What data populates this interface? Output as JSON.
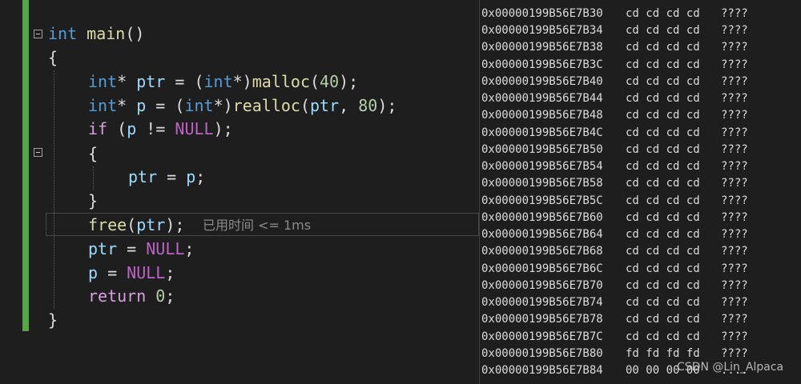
{
  "code": {
    "line1": {
      "kw": "int",
      "fn": "main",
      "rest": "()"
    },
    "line2": "{",
    "line3": {
      "t1": "int",
      "t2": "* ",
      "id1": "ptr",
      "t3": " = (",
      "t4": "int",
      "t5": "*)",
      "fn": "malloc",
      "t6": "(",
      "num": "40",
      "t7": ");"
    },
    "line4": {
      "t1": "int",
      "t2": "* ",
      "id1": "p",
      "t3": " = (",
      "t4": "int",
      "t5": "*)",
      "fn": "realloc",
      "t6": "(",
      "id2": "ptr",
      "t7": ", ",
      "num": "80",
      "t8": ");"
    },
    "line5": {
      "kw": "if",
      "t1": " (",
      "id1": "p",
      "t2": " != ",
      "mac": "NULL",
      "t3": ");"
    },
    "line6": "{",
    "line7": {
      "id1": "ptr",
      "t1": " = ",
      "id2": "p",
      "t2": ";"
    },
    "line8": "}",
    "line9": {
      "fn": "free",
      "t1": "(",
      "id1": "ptr",
      "t2": ");"
    },
    "line10": {
      "id1": "ptr",
      "t1": " = ",
      "mac": "NULL",
      "t2": ";"
    },
    "line11": {
      "id1": "p",
      "t1": " = ",
      "mac": "NULL",
      "t2": ";"
    },
    "line12": {
      "kw": "return",
      "t1": " ",
      "num": "0",
      "t2": ";"
    },
    "line13": "}"
  },
  "perf_tip": "已用时间 <= 1ms",
  "memory_rows": [
    {
      "addr": "0x00000199B56E7B30",
      "bytes": "cd cd cd cd",
      "ascii": "????"
    },
    {
      "addr": "0x00000199B56E7B34",
      "bytes": "cd cd cd cd",
      "ascii": "????"
    },
    {
      "addr": "0x00000199B56E7B38",
      "bytes": "cd cd cd cd",
      "ascii": "????"
    },
    {
      "addr": "0x00000199B56E7B3C",
      "bytes": "cd cd cd cd",
      "ascii": "????"
    },
    {
      "addr": "0x00000199B56E7B40",
      "bytes": "cd cd cd cd",
      "ascii": "????"
    },
    {
      "addr": "0x00000199B56E7B44",
      "bytes": "cd cd cd cd",
      "ascii": "????"
    },
    {
      "addr": "0x00000199B56E7B48",
      "bytes": "cd cd cd cd",
      "ascii": "????"
    },
    {
      "addr": "0x00000199B56E7B4C",
      "bytes": "cd cd cd cd",
      "ascii": "????"
    },
    {
      "addr": "0x00000199B56E7B50",
      "bytes": "cd cd cd cd",
      "ascii": "????"
    },
    {
      "addr": "0x00000199B56E7B54",
      "bytes": "cd cd cd cd",
      "ascii": "????"
    },
    {
      "addr": "0x00000199B56E7B58",
      "bytes": "cd cd cd cd",
      "ascii": "????"
    },
    {
      "addr": "0x00000199B56E7B5C",
      "bytes": "cd cd cd cd",
      "ascii": "????"
    },
    {
      "addr": "0x00000199B56E7B60",
      "bytes": "cd cd cd cd",
      "ascii": "????"
    },
    {
      "addr": "0x00000199B56E7B64",
      "bytes": "cd cd cd cd",
      "ascii": "????"
    },
    {
      "addr": "0x00000199B56E7B68",
      "bytes": "cd cd cd cd",
      "ascii": "????"
    },
    {
      "addr": "0x00000199B56E7B6C",
      "bytes": "cd cd cd cd",
      "ascii": "????"
    },
    {
      "addr": "0x00000199B56E7B70",
      "bytes": "cd cd cd cd",
      "ascii": "????"
    },
    {
      "addr": "0x00000199B56E7B74",
      "bytes": "cd cd cd cd",
      "ascii": "????"
    },
    {
      "addr": "0x00000199B56E7B78",
      "bytes": "cd cd cd cd",
      "ascii": "????"
    },
    {
      "addr": "0x00000199B56E7B7C",
      "bytes": "cd cd cd cd",
      "ascii": "????"
    },
    {
      "addr": "0x00000199B56E7B80",
      "bytes": "fd fd fd fd",
      "ascii": "????"
    },
    {
      "addr": "0x00000199B56E7B84",
      "bytes": "00 00 00 00",
      "ascii": "...."
    }
  ],
  "watermark": "CSDN @Lin_Alpaca",
  "colors": {
    "background": "#1e1e1e",
    "keyword": "#569cd6",
    "control": "#d8a0df",
    "function": "#dcdcaa",
    "number": "#b5cea8",
    "identifier": "#9cdcfe",
    "macro": "#bd63c5",
    "changed_bar": "#57a64a"
  }
}
